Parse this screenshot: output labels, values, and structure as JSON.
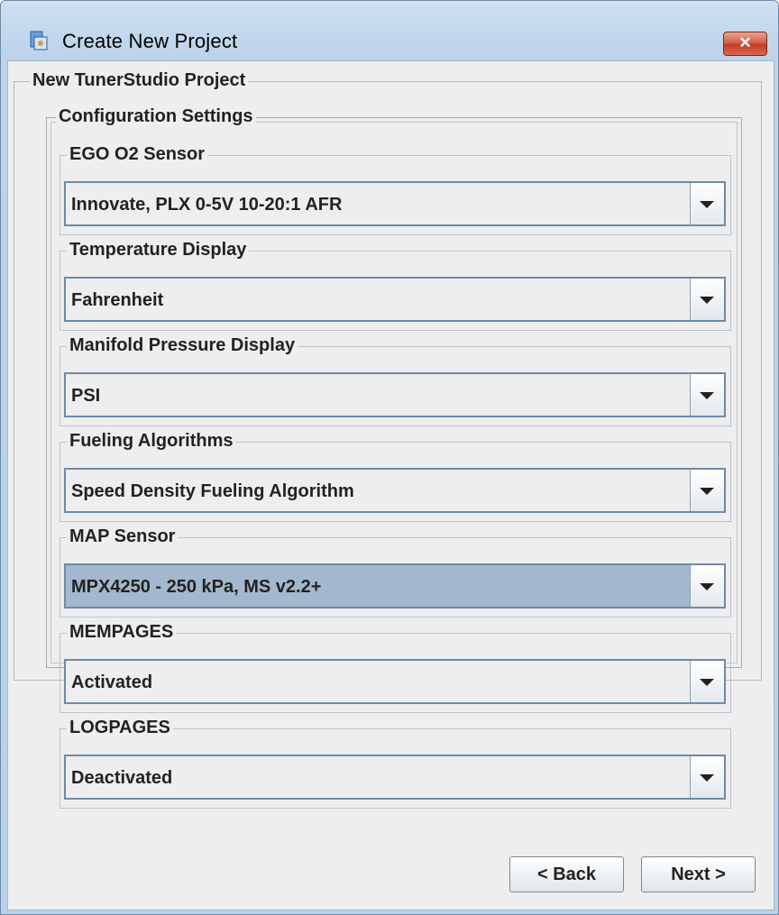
{
  "window": {
    "title": "Create New Project",
    "close_glyph": "✕",
    "icon": "project-icon"
  },
  "project_group": {
    "title": "New TunerStudio Project"
  },
  "config_group": {
    "title": "Configuration Settings"
  },
  "fields": [
    {
      "label": "EGO O2 Sensor",
      "value": "Innovate, PLX 0-5V 10-20:1 AFR"
    },
    {
      "label": "Temperature Display",
      "value": "Fahrenheit"
    },
    {
      "label": "Manifold Pressure Display",
      "value": "PSI"
    },
    {
      "label": "Fueling Algorithms",
      "value": "Speed Density Fueling Algorithm"
    },
    {
      "label": "MAP Sensor",
      "value": "MPX4250 - 250 kPa, MS v2.2+",
      "selected": true
    },
    {
      "label": "MEMPAGES",
      "value": "Activated"
    },
    {
      "label": "LOGPAGES",
      "value": "Deactivated"
    }
  ],
  "buttons": {
    "back": "< Back",
    "next": "Next >"
  },
  "colors": {
    "selected_combo": "#a3b8cc",
    "close_button": "#c23b24",
    "frame": "#b9d1e8"
  }
}
